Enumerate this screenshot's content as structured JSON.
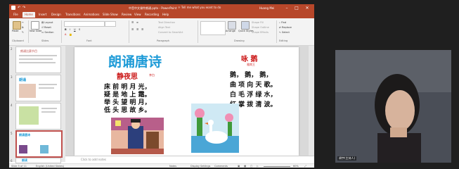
{
  "window": {
    "title": "中音中文课件朗诵.pptx - PowerPoint",
    "search_hint": "Tell me what you want to do",
    "user": "Huang Mei",
    "min": "–",
    "max": "□",
    "close": "✕"
  },
  "tabs": [
    "File",
    "Home",
    "Insert",
    "Design",
    "Transitions",
    "Animations",
    "Slide Show",
    "Review",
    "View",
    "Recording",
    "Help"
  ],
  "ribbon": {
    "paste": "Paste",
    "new_slide": "New Slide",
    "layout": "Layout",
    "reset": "Reset",
    "section": "Section",
    "text_direction": "Text Direction",
    "align_text": "Align Text",
    "convert_smartart": "Convert to SmartArt",
    "arrange": "Arrange",
    "quick_styles": "Quick Styles",
    "shape_fill": "Shape Fill",
    "shape_outline": "Shape Outline",
    "shape_effects": "Shape Effects",
    "find": "Find",
    "replace": "Replace",
    "select": "Select",
    "groups": {
      "clipboard": "Clipboard",
      "slides": "Slides",
      "font": "Font",
      "paragraph": "Paragraph",
      "drawing": "Drawing",
      "editing": "Editing"
    }
  },
  "thumbnails": [
    {
      "num": "2",
      "title": "朗诵比赛节目"
    },
    {
      "num": "3",
      "title": "朗诵"
    },
    {
      "num": "4",
      "title": ""
    },
    {
      "num": "5",
      "title": "朗诵唐诗"
    },
    {
      "num": "6",
      "title": "朗读"
    }
  ],
  "slide": {
    "heading": "朗诵唐诗",
    "poem1_title": "静夜思",
    "poem1_author": "李白",
    "poem1_lines": [
      "床 前 明 月 光，",
      "疑 是 地 上 霜。",
      "举 头 望 明 月，",
      "低 头 思 故 乡。"
    ],
    "poem2_title": "咏 鹅",
    "poem2_author": "骆宾王",
    "poem2_lines": [
      "鹅， 鹅， 鹅，",
      "曲 项 向 天 歌。",
      "白 毛 浮 绿 水，",
      "红 掌 拨 清 波。"
    ]
  },
  "notes_placeholder": "Click to add notes",
  "status": {
    "slide_pos": "Slide 5 of 11",
    "language": "English (United States)",
    "notes": "Notes",
    "display_settings": "Display Settings",
    "comments": "Comments",
    "zoom": "60%"
  },
  "camera": {
    "name": "胡宇(主持人)"
  },
  "colors": {
    "ppt_accent": "#b7472a",
    "heading_blue": "#1e9bd7",
    "title_red": "#cc1a1a"
  }
}
